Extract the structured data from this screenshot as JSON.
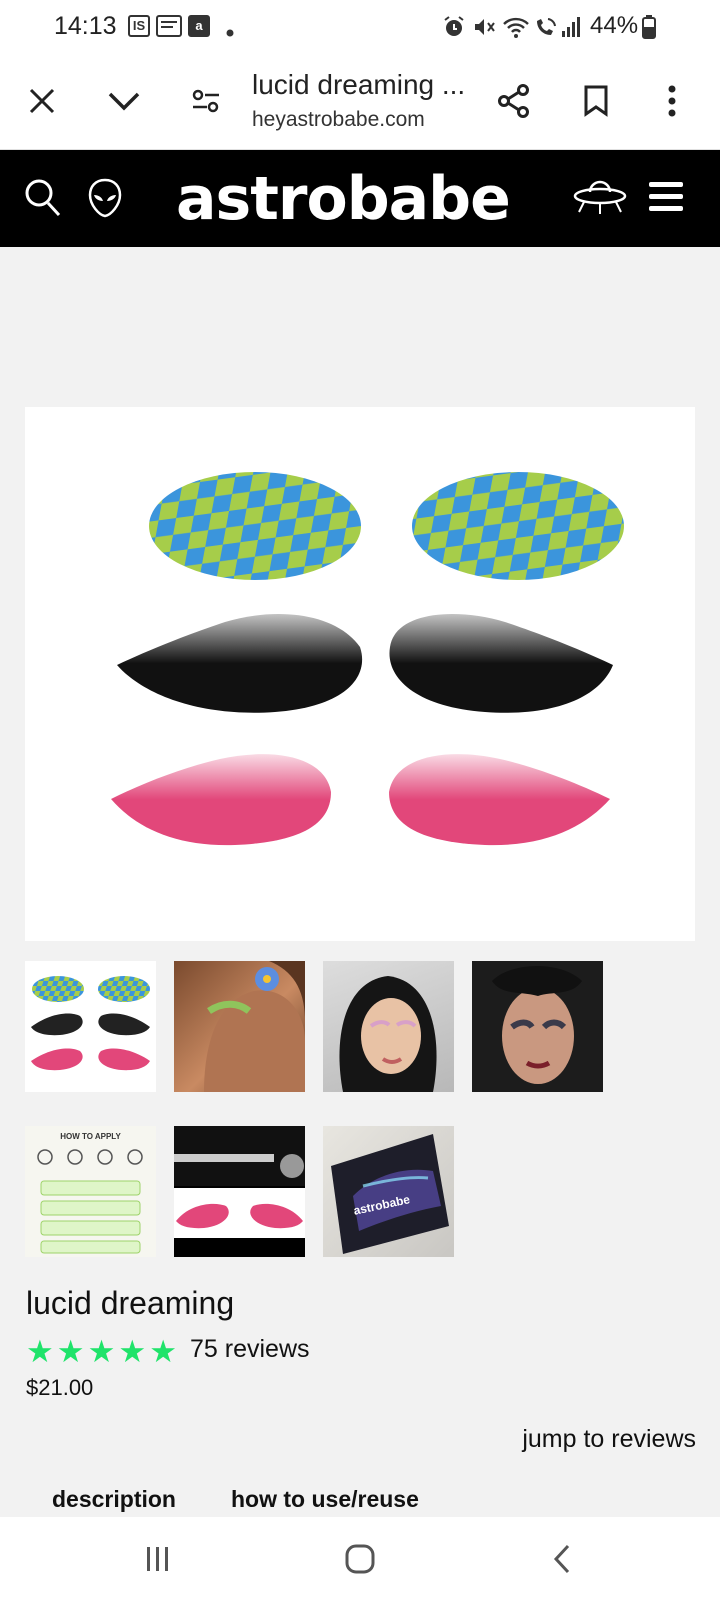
{
  "status_bar": {
    "time": "14:13",
    "notif_icons": [
      "IS",
      "chat-icon",
      "a"
    ],
    "battery": "44%"
  },
  "browser": {
    "title": "lucid dreaming ...",
    "url": "heyastrobabe.com"
  },
  "site": {
    "logo": "astrobabe"
  },
  "product": {
    "title": "lucid dreaming",
    "rating": 5,
    "reviews": "75 reviews",
    "price": "$21.00",
    "jump_link": "jump to reviews",
    "tabs": [
      "description",
      "how to use/reuse"
    ]
  },
  "thumbnails": {
    "how_to_heading": "HOW TO APPLY",
    "box_logo": "astrobabe"
  },
  "colors": {
    "star": "#1fe36a",
    "header_bg": "#000000",
    "blue": "#3b95dc",
    "green": "#a6cd4a",
    "pink": "#e2477a"
  }
}
